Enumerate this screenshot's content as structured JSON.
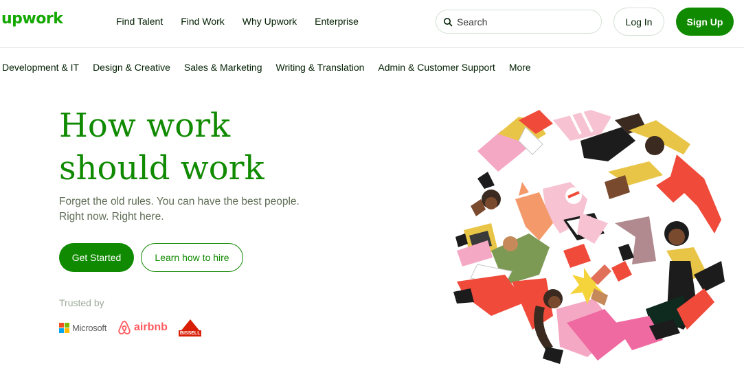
{
  "header": {
    "logo": "upwork",
    "nav": [
      "Find Talent",
      "Find Work",
      "Why Upwork",
      "Enterprise"
    ],
    "search_placeholder": "Search",
    "login_label": "Log In",
    "signup_label": "Sign Up"
  },
  "categories": [
    "Development & IT",
    "Design & Creative",
    "Sales & Marketing",
    "Writing & Translation",
    "Admin & Customer Support",
    "More"
  ],
  "hero": {
    "title_line1": "How work",
    "title_line2": "should work",
    "subtitle_line1": "Forget the old rules. You can have the best people.",
    "subtitle_line2": "Right now. Right here.",
    "get_started_label": "Get Started",
    "learn_label": "Learn how to hire",
    "trusted_by": "Trusted by",
    "brands": [
      "Microsoft",
      "airbnb",
      "BISSELL"
    ]
  },
  "colors": {
    "brand_green": "#14a800",
    "button_green": "#108a00",
    "airbnb": "#ff5a5f",
    "bissell": "#d81e05"
  },
  "icons": {
    "search": "search-icon",
    "illustration": "people-circle-illustration"
  }
}
